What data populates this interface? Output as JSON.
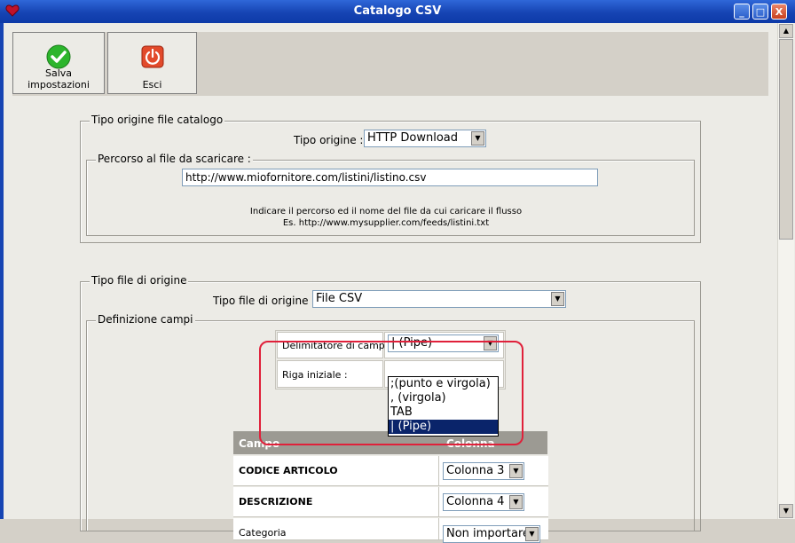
{
  "window": {
    "title": "Catalogo CSV",
    "minimize": "_",
    "maximize": "□",
    "close": "X"
  },
  "toolbar": {
    "save_label": "Salva impostazioni",
    "exit_label": "Esci"
  },
  "origin_group": {
    "legend": "Tipo origine file catalogo",
    "type_label": "Tipo origine :",
    "type_value": "HTTP Download",
    "path_legend": "Percorso al file da scaricare :",
    "path_value": "http://www.miofornitore.com/listini/listino.csv",
    "hint_line1": "Indicare il percorso ed il nome del file da cui caricare il flusso",
    "hint_line2": "Es. http://www.mysupplier.com/feeds/listini.txt"
  },
  "file_group": {
    "legend": "Tipo file di origine",
    "type_label": "Tipo file di origine :",
    "type_value": "File CSV",
    "fields_legend": "Definizione campi",
    "delimiter_label": "Delimitatore di campo :",
    "delimiter_value": "| (Pipe)",
    "delimiter_options": [
      ";(punto e virgola)",
      ", (virgola)",
      "TAB",
      "| (Pipe)"
    ],
    "start_row_label": "Riga iniziale :"
  },
  "mapping_table": {
    "header_field": "Campo",
    "header_column": "Colonna",
    "rows": [
      {
        "name": "CODICE ARTICOLO",
        "column": "Colonna 3"
      },
      {
        "name": "DESCRIZIONE",
        "column": "Colonna 4"
      },
      {
        "name": "Categoria",
        "column": "Non importare"
      }
    ]
  },
  "colors": {
    "titlebar": "#1644b3",
    "highlight": "#e0203a",
    "selection": "#0a246a"
  }
}
